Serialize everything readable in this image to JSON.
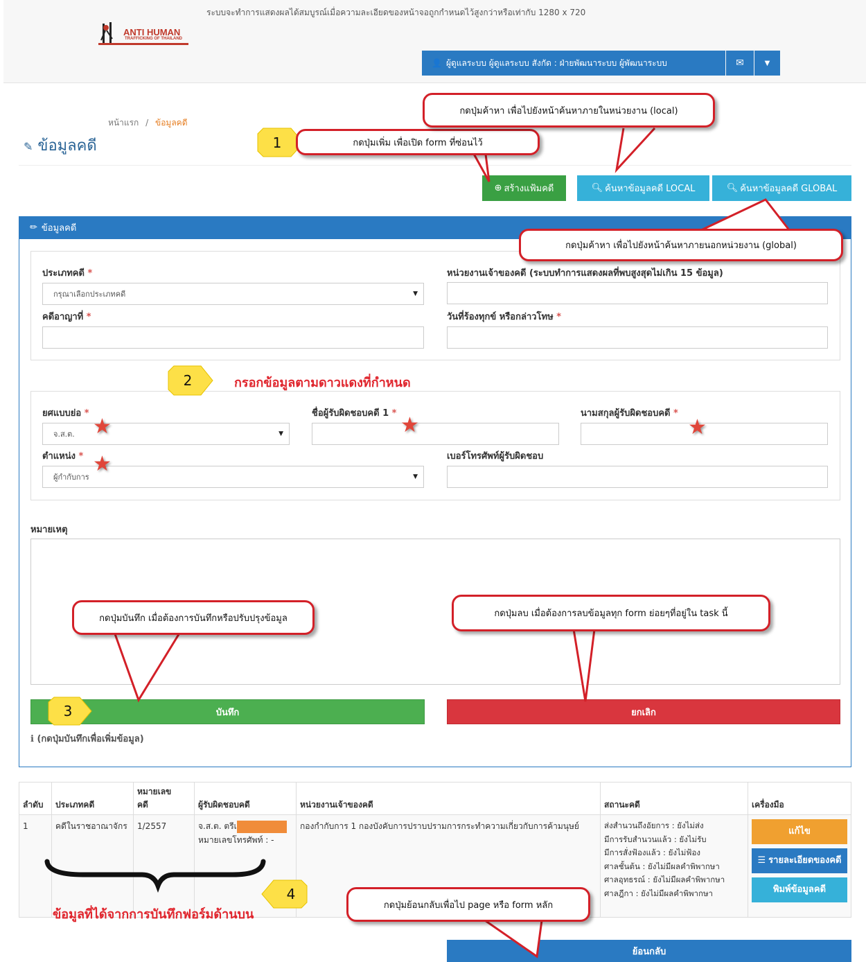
{
  "header": {
    "notice": "ระบบจะทำการแสดงผลได้สมบูรณ์เมื่อความละเอียดของหน้าจอถูกกำหนดไว้สูงกว่าหรือเท่ากับ 1280 x 720",
    "logo_text_1": "ANTI HUMAN",
    "logo_text_2": "TRAFFICKING OF THAILAND",
    "user_label": "ผู้ดูแลระบบ ผู้ดูแลระบบ สังกัด : ฝ่ายพัฒนาระบบ ผู้พัฒนาระบบ"
  },
  "breadcrumb": {
    "home": "หน้าแรก",
    "sep": "/",
    "current": "ข้อมูลคดี"
  },
  "page_title": "ข้อมูลคดี",
  "toolbar": {
    "add_label": "สร้างแฟ้มคดี",
    "search_local_label": "ค้นหาข้อมูลคดี LOCAL",
    "search_global_label": "ค้นหาข้อมูลคดี GLOBAL"
  },
  "panel": {
    "title": "ข้อมูลคดี"
  },
  "form": {
    "case_type_label": "ประเภทคดี",
    "case_type_value": "กรุณาเลือกประเภทคดี",
    "owner_unit_label": "หน่วยงานเจ้าของคดี (ระบบทำการแสดงผลที่พบสูงสุดไม่เกิน 15 ข้อมูล)",
    "criminal_case_label": "คดีอาญาที่",
    "complaint_date_label": "วันที่ร้องทุกข์ หรือกล่าวโทษ",
    "rank_label": "ยศแบบย่อ",
    "rank_value": "จ.ส.ต.",
    "first_name_label": "ชื่อผู้รับผิดชอบคดี 1",
    "last_name_label": "นามสกุลผู้รับผิดชอบคดี",
    "position_label": "ตำแหน่ง",
    "position_value": "ผู้กำกับการ",
    "phone_label": "เบอร์โทรศัพท์ผู้รับผิดชอบ",
    "remarks_label": "หมายเหตุ",
    "required_mark": "*",
    "save_label": "บันทึก",
    "cancel_label": "ยกเลิก",
    "hint": "(กดปุ่มบันทึกเพื่อเพิ่มข้อมูล)"
  },
  "table": {
    "headers": [
      "ลำดับ",
      "ประเภทคดี",
      "หมายเลขคดี",
      "ผู้รับผิดชอบคดี",
      "หน่วยงานเจ้าของคดี",
      "สถานะคดี",
      "เครื่องมือ"
    ],
    "header_no_line1": "หมายเลข",
    "header_no_line2": "คดี",
    "row": {
      "index": "1",
      "case_type": "คดีในราชอาณาจักร",
      "case_no": "1/2557",
      "responsible": "จ.ส.ต. ตรีเ",
      "phone": "หมายเลขโทรศัพท์ : -",
      "owner_unit": "กองกำกับการ 1 กองบังคับการปราบปรามการกระทำความเกี่ยวกับการค้ามนุษย์",
      "status": [
        "ส่งสำนวนถึงอัยการ : ยังไม่ส่ง",
        "มีการรับสำนวนแล้ว : ยังไม่รับ",
        "มีการสั่งฟ้องแล้ว : ยังไม่ฟ้อง",
        "ศาลชั้นต้น : ยังไม่มีผลคำพิพากษา",
        "ศาลอุทธรณ์ : ยังไม่มีผลคำพิพากษา",
        "ศาลฎีกา : ยังไม่มีผลคำพิพากษา"
      ],
      "edit_label": "แก้ไข",
      "detail_label": "รายละเอียดของคดี",
      "print_label": "พิมพ์ข้อมูลคดี"
    }
  },
  "back_label": "ย้อนกลับ",
  "annotations": {
    "c1": "กดปุ่มเพิ่ม เพื่อเปิด form ที่ซ่อนไว้",
    "c_local": "กดปุ่มค้าหา เพื่อไปยังหน้าค้นหาภายในหน่วยงาน (local)",
    "c_global": "กดปุ่มค้าหา เพื่อไปยังหน้าค้นหาภายนอกหน่วยงาน (global)",
    "c_save": "กดปุ่มบันทึก เมื่อต้องการบันทึกหรือปรับปรุงข้อมูล",
    "c_cancel": "กดปุ่มลบ เมื่อต้องการลบข้อมูลทุก form ย่อยๆที่อยู่ใน task นี้",
    "c_back": "กดปุ่มย้อนกลับเพื่อไป page หรือ form หลัก",
    "note2": "กรอกข้อมูลตามดาวแดงที่กำหนด",
    "note4": "ข้อมูลที่ได้จากการบันทึกฟอร์มด้านบน",
    "b1": "1",
    "b2": "2",
    "b3": "3",
    "b4": "4"
  },
  "colors": {
    "primary": "#2a7ac2",
    "success": "#3aa043",
    "info": "#36b1d9",
    "danger": "#d9363e",
    "warning": "#f0a030",
    "annotation": "#d32028"
  }
}
